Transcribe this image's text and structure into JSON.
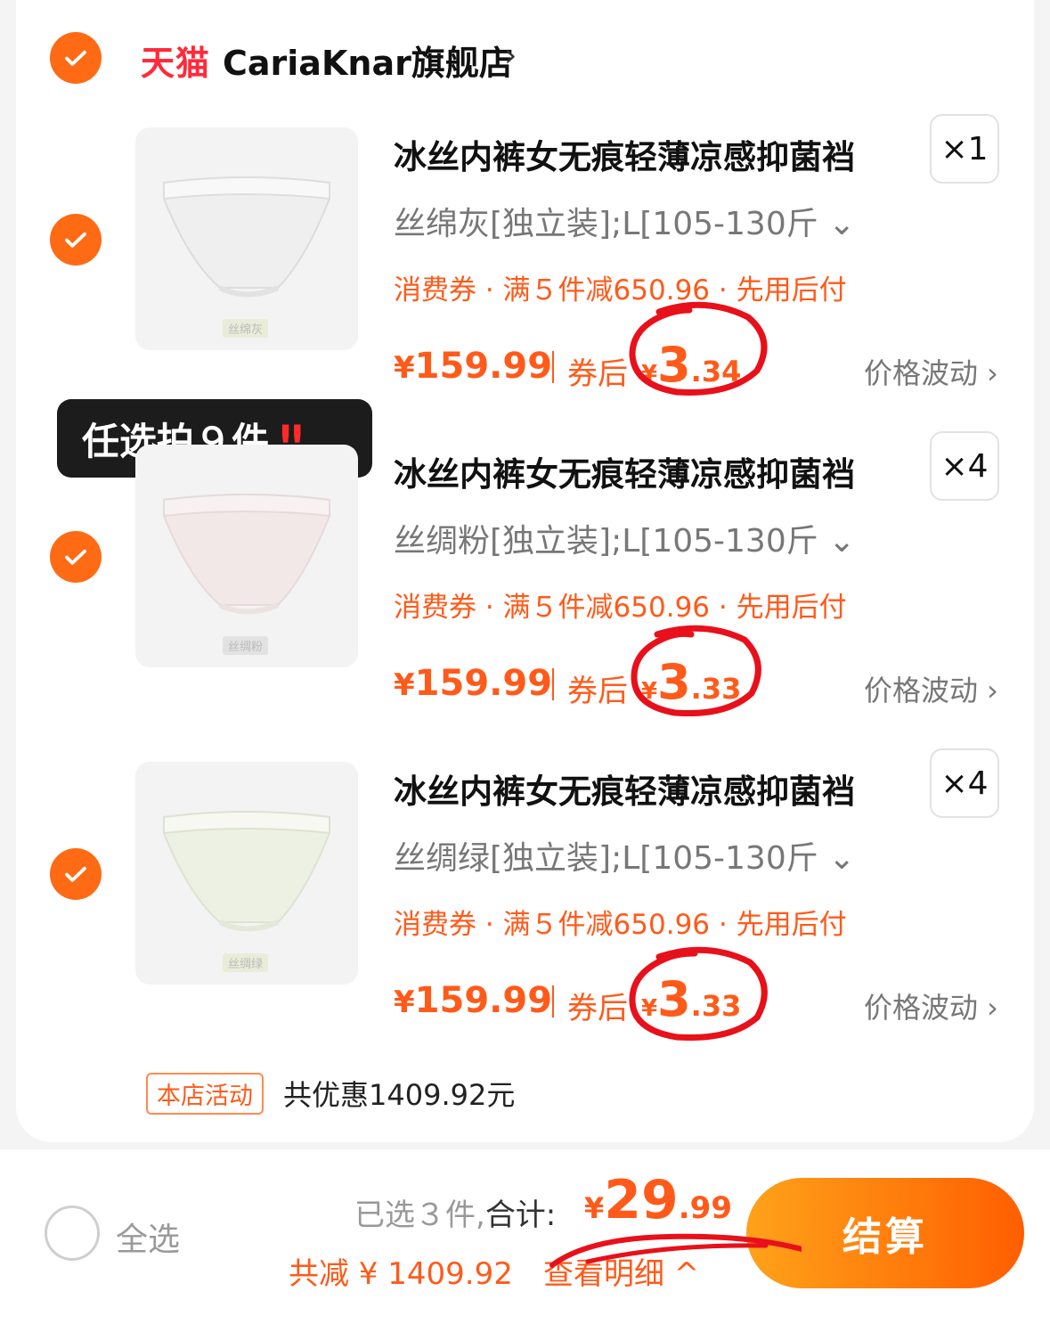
{
  "shop": {
    "mall": "天猫",
    "name": "CariaKnar旗舰店",
    "chevron": "›"
  },
  "badge": {
    "text": "任选拍９件",
    "excl": "‼"
  },
  "items": [
    {
      "thumb_label": "丝绵灰",
      "title": "冰丝内裤女无痕轻薄凉感抑菌裆",
      "qty": "×1",
      "sku": "丝绵灰[独立装];L[105-130斤 ⌄",
      "coupon": "消费券 · 满５件减650.96 · 先用后付",
      "price_symbol": "¥",
      "price": "159.99",
      "after_label": "券后",
      "after_symbol": "¥",
      "after_int": "3",
      "after_dec": ".34",
      "fluct": "价格波动 ›"
    },
    {
      "thumb_label": "丝绸粉",
      "title": "冰丝内裤女无痕轻薄凉感抑菌裆",
      "qty": "×4",
      "sku": "丝绸粉[独立装];L[105-130斤 ⌄",
      "coupon": "消费券 · 满５件减650.96 · 先用后付",
      "price_symbol": "¥",
      "price": "159.99",
      "after_label": "券后",
      "after_symbol": "¥",
      "after_int": "3",
      "after_dec": ".33",
      "fluct": "价格波动 ›"
    },
    {
      "thumb_label": "丝绸绿",
      "title": "冰丝内裤女无痕轻薄凉感抑菌裆",
      "qty": "×4",
      "sku": "丝绸绿[独立装];L[105-130斤 ⌄",
      "coupon": "消费券 · 满５件减650.96 · 先用后付",
      "price_symbol": "¥",
      "price": "159.99",
      "after_label": "券后",
      "after_symbol": "¥",
      "after_int": "3",
      "after_dec": ".33",
      "fluct": "价格波动 ›"
    }
  ],
  "activity": {
    "tag": "本店活动",
    "text": "共优惠1409.92元"
  },
  "footer": {
    "select_all": "全选",
    "selected": "已选３件,",
    "total_label": "合计:",
    "total_symbol": "¥",
    "total_int": "29",
    "total_dec": ".99",
    "reduce": "共减 ¥ 1409.92",
    "detail": "查看明细 ^",
    "checkout": "结算"
  },
  "colors": {
    "accent": "#ff5a1a",
    "mall": "#ff2a3a",
    "annotation": "#e8101a"
  }
}
